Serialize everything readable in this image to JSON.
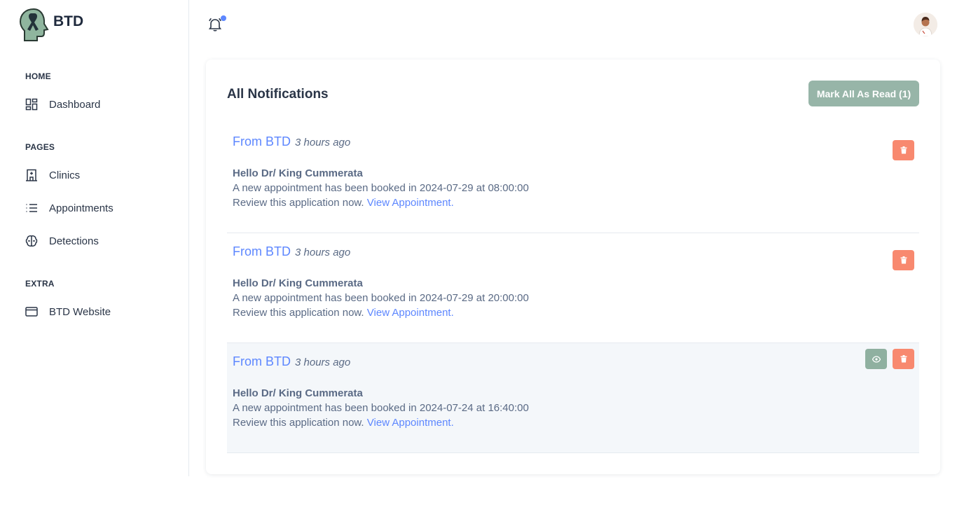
{
  "brand": {
    "name": "BTD"
  },
  "sidebar": {
    "sections": [
      {
        "title": "HOME",
        "items": [
          {
            "label": "Dashboard",
            "icon": "dashboard-icon"
          }
        ]
      },
      {
        "title": "PAGES",
        "items": [
          {
            "label": "Clinics",
            "icon": "building-icon"
          },
          {
            "label": "Appointments",
            "icon": "list-icon"
          },
          {
            "label": "Detections",
            "icon": "brain-icon"
          }
        ]
      },
      {
        "title": "EXTRA",
        "items": [
          {
            "label": "BTD Website",
            "icon": "browser-icon"
          }
        ]
      }
    ]
  },
  "header": {
    "notification_icon": "bell-icon",
    "has_unread": true,
    "avatar_icon": "user-avatar"
  },
  "main": {
    "title": "All Notifications",
    "mark_all_label": "Mark All As Read (1)",
    "notifications": [
      {
        "from": "From BTD",
        "time": "3 hours ago",
        "greeting": "Hello Dr/ King Cummerata",
        "message": "A new appointment has been booked in 2024-07-29 at 08:00:00",
        "review_text": "Review this application now.",
        "link_text": "View Appointment.",
        "unread": false
      },
      {
        "from": "From BTD",
        "time": "3 hours ago",
        "greeting": "Hello Dr/ King Cummerata",
        "message": "A new appointment has been booked in 2024-07-29 at 20:00:00",
        "review_text": "Review this application now.",
        "link_text": "View Appointment.",
        "unread": false
      },
      {
        "from": "From BTD",
        "time": "3 hours ago",
        "greeting": "Hello Dr/ King Cummerata",
        "message": "A new appointment has been booked in 2024-07-24 at 16:40:00",
        "review_text": "Review this application now.",
        "link_text": "View Appointment.",
        "unread": true
      }
    ]
  },
  "colors": {
    "accent": "#5d87ff",
    "sage": "#97b5a8",
    "danger": "#f8896f",
    "unread_bg": "#f4f7fa"
  }
}
